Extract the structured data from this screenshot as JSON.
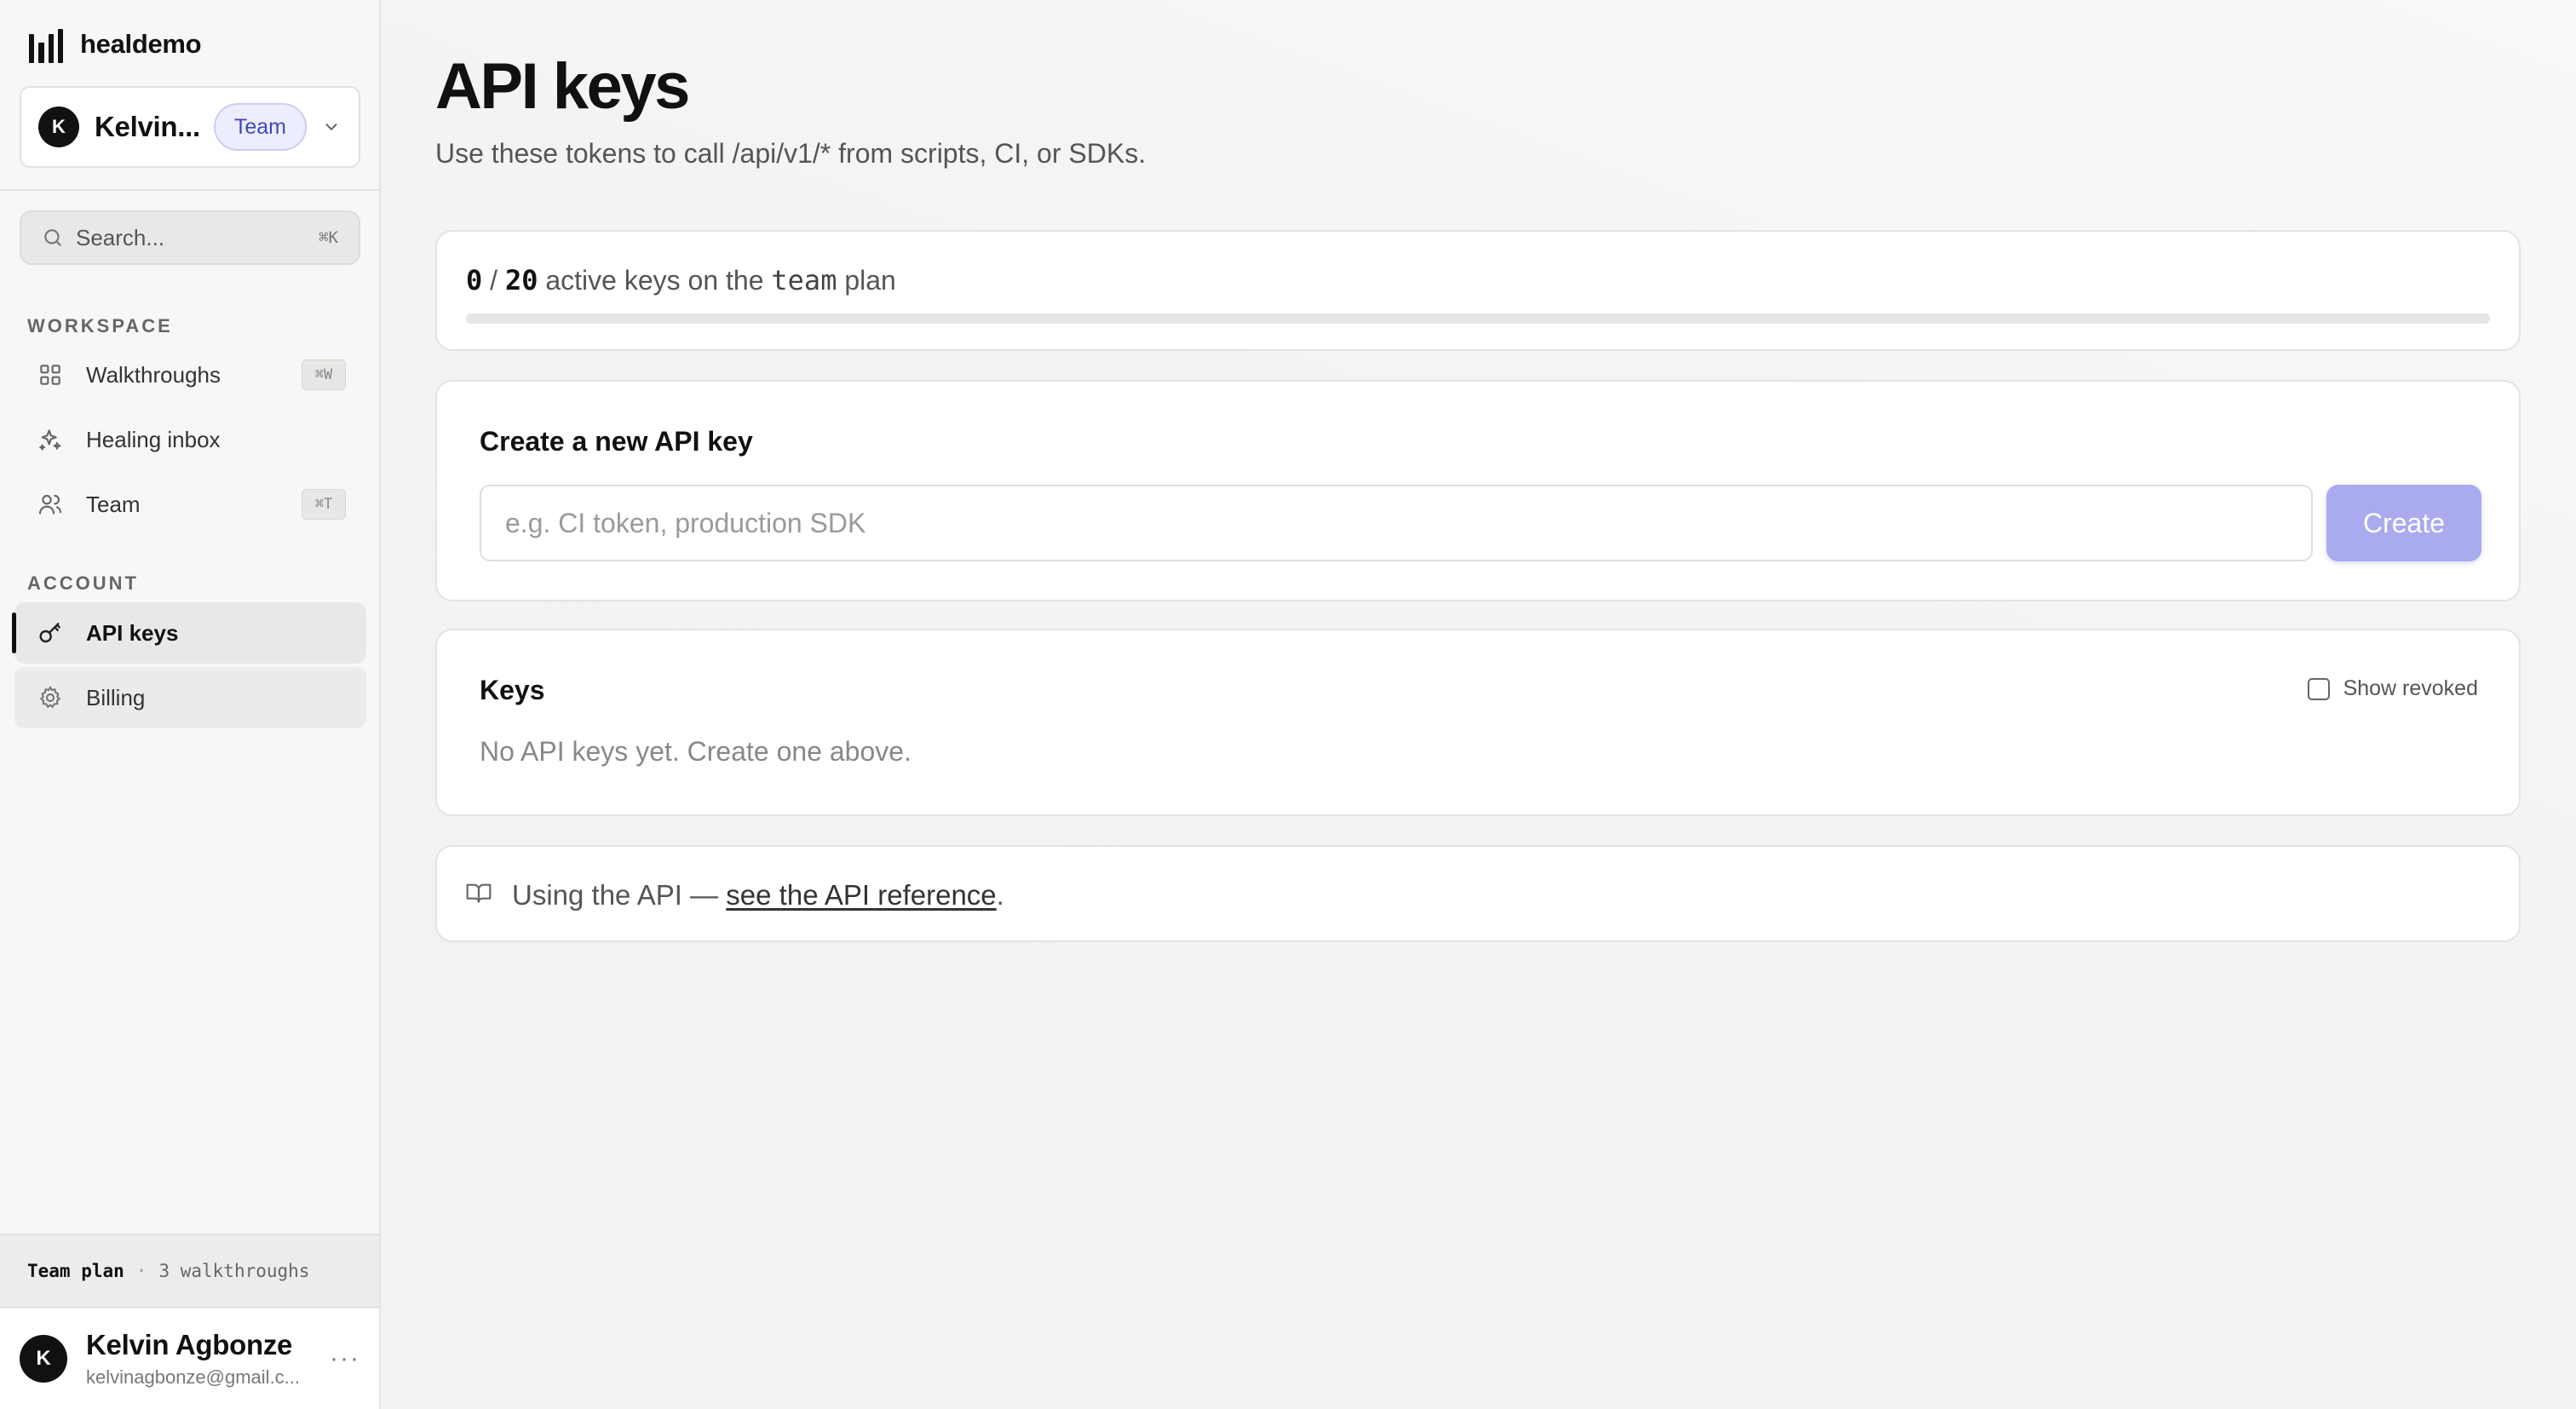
{
  "brand": {
    "name": "healdemo"
  },
  "workspace": {
    "avatar_initial": "K",
    "name": "Kelvin...",
    "plan_badge": "Team"
  },
  "search": {
    "placeholder": "Search...",
    "shortcut": "⌘K"
  },
  "sidebar": {
    "sections": [
      {
        "label": "WORKSPACE",
        "items": [
          {
            "label": "Walkthroughs",
            "icon": "grid-icon",
            "shortcut": "⌘W"
          },
          {
            "label": "Healing inbox",
            "icon": "sparkles-icon",
            "shortcut": ""
          },
          {
            "label": "Team",
            "icon": "users-icon",
            "shortcut": "⌘T"
          }
        ]
      },
      {
        "label": "ACCOUNT",
        "items": [
          {
            "label": "API keys",
            "icon": "key-icon",
            "active": true
          },
          {
            "label": "Billing",
            "icon": "gear-icon",
            "hovered": true
          }
        ]
      }
    ]
  },
  "plan_status": {
    "plan": "Team plan",
    "separator": "·",
    "usage": "3 walkthroughs"
  },
  "user": {
    "avatar_initial": "K",
    "name": "Kelvin Agbonze",
    "email": "kelvinagbonze@gmail.c...",
    "menu": "···"
  },
  "page": {
    "title": "API keys",
    "subtitle": "Use these tokens to call /api/v1/* from scripts, CI, or SDKs."
  },
  "usage": {
    "active": "0",
    "separator": " / ",
    "limit": "20",
    "text_before_plan": " active keys on the ",
    "plan": "team",
    "text_after_plan": " plan",
    "progress_fraction": 0
  },
  "create_key": {
    "heading": "Create a new API key",
    "input_placeholder": "e.g. CI token, production SDK",
    "input_value": "",
    "button_label": "Create"
  },
  "keys": {
    "heading": "Keys",
    "show_revoked_label": "Show revoked",
    "show_revoked_checked": false,
    "empty_message": "No API keys yet. Create one above."
  },
  "docs": {
    "icon": "book-open-icon",
    "prefix": "Using the API — ",
    "link_text": "see the API reference",
    "suffix": "."
  },
  "colors": {
    "accent": "#6a6fe0",
    "button_disabled": "#a9abee",
    "badge_bg": "#eceefe",
    "badge_text": "#4049b8"
  }
}
